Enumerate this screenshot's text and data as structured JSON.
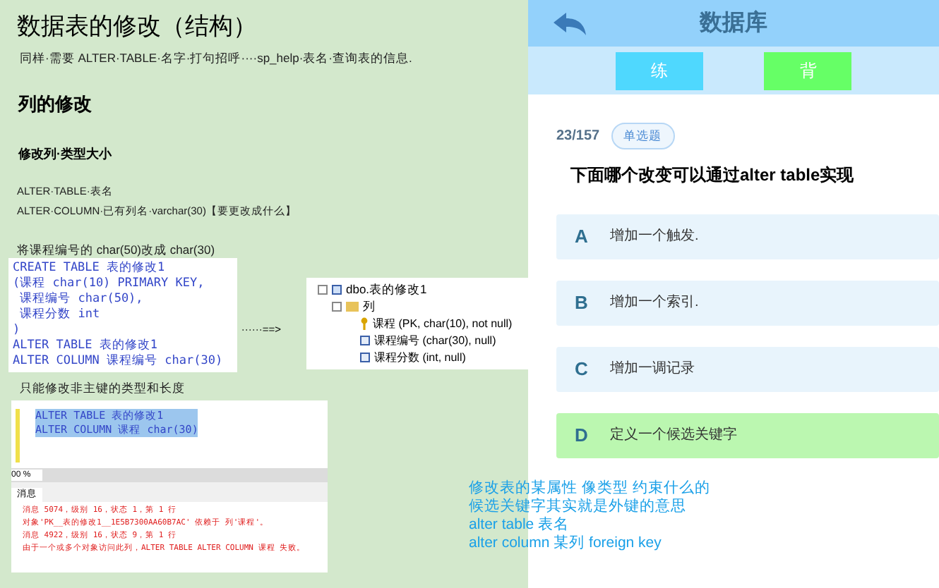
{
  "document": {
    "title": "数据表的修改（结构）",
    "intro": "同样·需要 ALTER·TABLE·名字·打句招呼····sp_help·表名·查询表的信息.",
    "section": "列的修改",
    "subsection": "修改列·类型大小",
    "syntax_lines": [
      "ALTER·TABLE·表名",
      "ALTER·COLUMN·已有列名·varchar(30)【要更改成什么】"
    ],
    "task": "将课程编号的 char(50)改成 char(30)",
    "code_lines": [
      "CREATE TABLE 表的修改1",
      "(课程 char(10) PRIMARY KEY,",
      " 课程编号 char(50),",
      " 课程分数 int",
      ")",
      "ALTER TABLE 表的修改1",
      "ALTER COLUMN 课程编号 char(30)"
    ],
    "arrow": "······==>",
    "tree": {
      "table": "dbo.表的修改1",
      "folder": "列",
      "columns": [
        {
          "text": "课程 (PK, char(10), not null)",
          "kind": "key"
        },
        {
          "text": "课程编号 (char(30), null)",
          "kind": "column"
        },
        {
          "text": "课程分数 (int, null)",
          "kind": "column"
        }
      ]
    },
    "note": "只能修改非主键的类型和长度",
    "query_lines": [
      "ALTER TABLE 表的修改1",
      "ALTER COLUMN 课程 char(30)"
    ],
    "zoom_level": "00 %",
    "messages_tab": "消息",
    "messages": [
      "消息 5074，级别 16，状态 1，第 1 行",
      "对象'PK__表的修改1__1E5B7300AA60B7AC' 依赖于 列'课程'。",
      "消息 4922，级别 16，状态 9，第 1 行",
      "由于一个或多个对象访问此列，ALTER TABLE ALTER COLUMN 课程 失败。"
    ]
  },
  "quiz": {
    "title": "数据库",
    "modes": [
      {
        "label": "练",
        "color": "#4fd8fe"
      },
      {
        "label": "背",
        "color": "#66ff66"
      }
    ],
    "counter": "23/157",
    "type": "单选题",
    "question": "下面哪个改变可以通过alter table实现",
    "options": [
      {
        "letter": "A",
        "text": "增加一个触发.",
        "selected": false
      },
      {
        "letter": "B",
        "text": "增加一个索引.",
        "selected": false
      },
      {
        "letter": "C",
        "text": "增加一调记录",
        "selected": false
      },
      {
        "letter": "D",
        "text": "定义一个候选关键字",
        "selected": true
      }
    ]
  },
  "annotation": [
    "修改表的某属性 像类型 约束什么的",
    "候选关键字其实就是外键的意思",
    "alter table 表名",
    "alter column 某列 foreign key"
  ]
}
